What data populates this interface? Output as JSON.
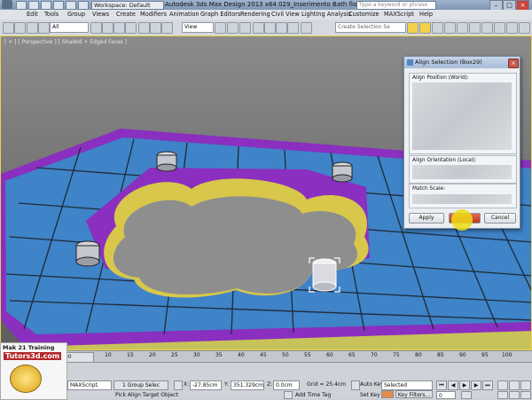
{
  "title_bar": {
    "workspace": "Workspace: Default",
    "title": "Autodesk 3ds Max Design 2013 x64      029_Inserimento Bath floor_2013.max",
    "search_placeholder": "Type a keyword or phrase"
  },
  "menu": [
    "Edit",
    "Tools",
    "Group",
    "Views",
    "Create",
    "Modifiers",
    "Animation",
    "Graph Editors",
    "Rendering",
    "Civil View",
    "Lighting Analysis",
    "Customize",
    "MAXScript",
    "Help"
  ],
  "toolbar": {
    "filter_value": "All",
    "ref_coord_value": "View",
    "named_selection_placeholder": "Create Selection Se"
  },
  "viewport": {
    "label": "[ + ] [ Perspective ] [ Shaded + Edged Faces ]"
  },
  "dialog": {
    "title": "Align Selection (Box29)",
    "align_position_label": "Align Position (World):",
    "align_orientation_label": "Align Orientation (Local):",
    "match_scale_label": "Match Scale:",
    "apply_label": "Apply",
    "cancel_label": "Cancel"
  },
  "timeline": {
    "slider_label": "0 / 100",
    "ticks": [
      "10",
      "15",
      "20",
      "25",
      "30",
      "35",
      "40",
      "45",
      "50",
      "55",
      "60",
      "65",
      "70",
      "75",
      "80",
      "85",
      "90",
      "95",
      "100"
    ]
  },
  "status": {
    "maxscript_text": "MAXScript.",
    "selection_count": "1 Group Selec",
    "prompt": "Pick Align Target Object",
    "x_label": "X:",
    "x_value": "-27.85cm",
    "y_label": "Y:",
    "y_value": "351.329cm",
    "z_label": "Z:",
    "z_value": "0.0cm",
    "grid": "Grid = 25.4cm",
    "add_time_tag": "Add Time Tag",
    "auto_key": "Auto Key",
    "set_key": "Set Key",
    "key_mode": "Selected",
    "key_filters": "Key Filters...",
    "frame": "0"
  },
  "watermark": {
    "line1": "Mak 21 Training",
    "line2": "Tutors3d.com"
  },
  "colors": {
    "floor_blue": "#3f83c8",
    "border_purple": "#8a2fc0",
    "selection_yellow": "#e5d44a"
  }
}
